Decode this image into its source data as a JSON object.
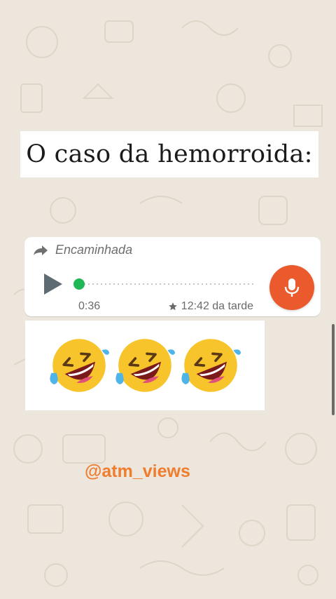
{
  "title": "O caso da hemorroida:",
  "message_audio": {
    "forwarded_label": "Encaminhada",
    "duration": "0:36",
    "timestamp": "12:42 da tarde",
    "progress": 0
  },
  "message_emoji": {
    "emojis": [
      "🤣",
      "🤣",
      "🤣"
    ]
  },
  "watermark": "@atm_views",
  "colors": {
    "background": "#ece6dc",
    "mic_button": "#ea5a2c",
    "progress_knob": "#1fb855",
    "watermark": "#f07c2e"
  },
  "icons": {
    "forward": "forward-arrow-icon",
    "play": "play-icon",
    "star": "star-icon",
    "mic": "microphone-icon"
  }
}
